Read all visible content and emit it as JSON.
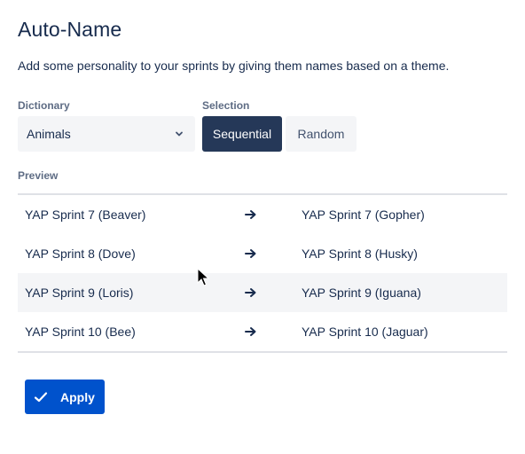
{
  "header": {
    "title": "Auto-Name",
    "description": "Add some personality to your sprints by giving them names based on a theme."
  },
  "dictionary": {
    "label": "Dictionary",
    "selected": "Animals",
    "icon": "chevron-down-icon"
  },
  "selection": {
    "label": "Selection",
    "options": [
      {
        "label": "Sequential",
        "active": true
      },
      {
        "label": "Random",
        "active": false
      }
    ]
  },
  "preview": {
    "label": "Preview",
    "rows": [
      {
        "from": "YAP Sprint 7 (Beaver)",
        "to": "YAP Sprint 7 (Gopher)"
      },
      {
        "from": "YAP Sprint 8 (Dove)",
        "to": "YAP Sprint 8 (Husky)"
      },
      {
        "from": "YAP Sprint 9 (Loris)",
        "to": "YAP Sprint 9 (Iguana)"
      },
      {
        "from": "YAP Sprint 10 (Bee)",
        "to": "YAP Sprint 10 (Jaguar)"
      }
    ],
    "arrow_icon": "arrow-right-icon"
  },
  "actions": {
    "apply_label": "Apply",
    "apply_icon": "check-icon"
  },
  "colors": {
    "primary": "#0052cc",
    "selected_segment": "#253858",
    "text": "#172b4d",
    "muted": "#5e6c84",
    "subtle_bg": "#f4f5f7"
  }
}
